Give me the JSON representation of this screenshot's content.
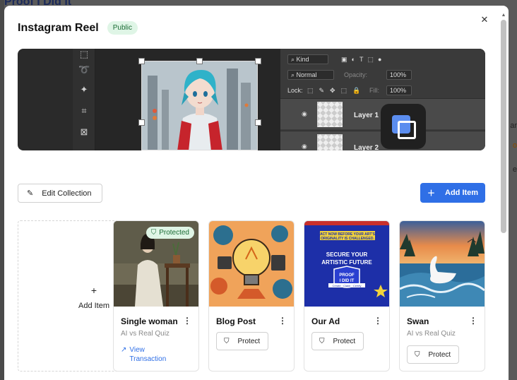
{
  "background": {
    "title": "Proof I Did It",
    "edge_texts": [
      "ar",
      "o",
      "e"
    ]
  },
  "modal": {
    "title": "Instagram Reel",
    "visibility_badge": "Public",
    "close_icon": "close-icon"
  },
  "banner": {
    "layers_panel": {
      "kind_label": "Kind",
      "blend_mode": "Normal",
      "opacity_label": "Opacity:",
      "opacity_value": "100%",
      "lock_label": "Lock:",
      "fill_label": "Fill:",
      "fill_value": "100%",
      "layers": [
        "Layer 1",
        "Layer 2"
      ]
    }
  },
  "actions": {
    "edit_collection": "Edit Collection",
    "add_item": "Add Item"
  },
  "items": {
    "add_tile_label": "Add Item",
    "cards": [
      {
        "title": "Single woman",
        "subtitle": "AI vs Real Quiz",
        "status": "Protected",
        "link_line1": "View",
        "link_line2": "Transaction"
      },
      {
        "title": "Blog Post",
        "subtitle": "",
        "button": "Protect"
      },
      {
        "title": "Our Ad",
        "subtitle": "",
        "button": "Protect",
        "image_text": {
          "l1": "ACT NOW BEFORE YOUR ART'S",
          "l2": "ORIGINALITY IS CHALLENGED.",
          "h1": "SECURE YOUR",
          "h2": "ARTISTIC FUTURE",
          "logo1": "PROOF",
          "logo2": "I DID IT",
          "tag": "Create · Claim · Certify"
        }
      },
      {
        "title": "Swan",
        "subtitle": "AI vs Real Quiz",
        "button": "Protect"
      }
    ]
  },
  "colors": {
    "accent": "#2f6fe6",
    "badge_bg": "#dff5e6",
    "badge_text": "#1a6b34"
  }
}
